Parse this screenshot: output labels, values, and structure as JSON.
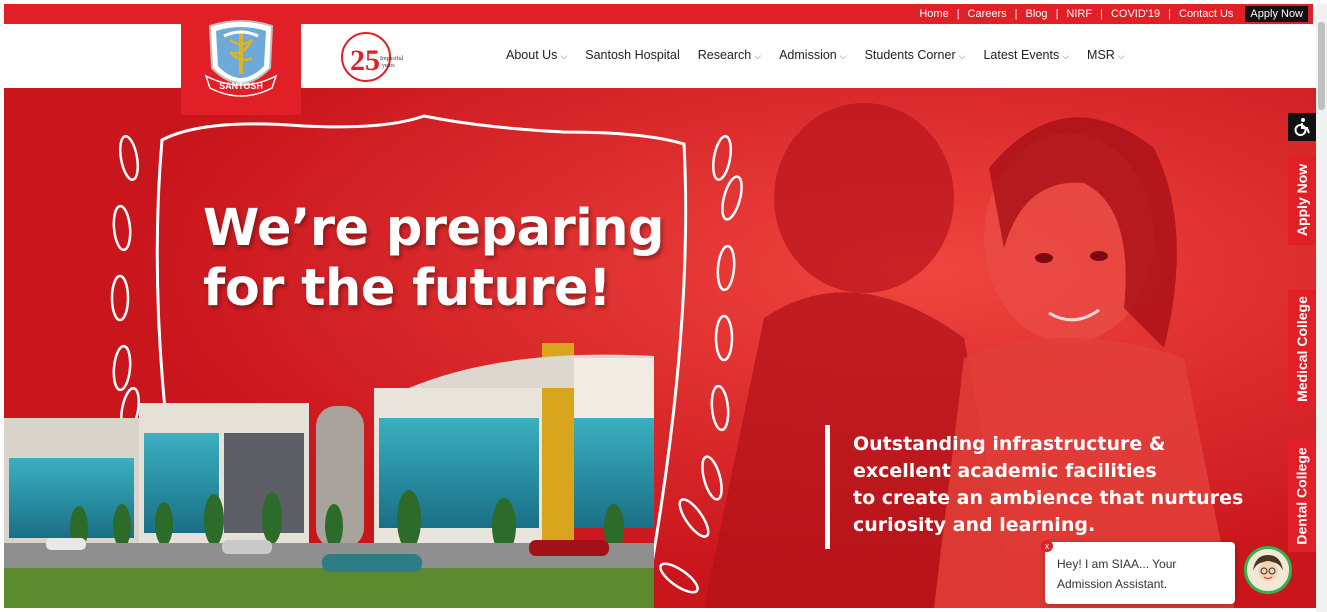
{
  "topbar": {
    "links": [
      "Home",
      "Careers",
      "Blog",
      "NIRF",
      "COVID'19",
      "Contact Us"
    ],
    "separator": "|",
    "apply_label": "Apply Now"
  },
  "logo": {
    "text": "SANTOSH"
  },
  "badge": {
    "number": "25",
    "line1": "Impactful",
    "line2": "years"
  },
  "nav": {
    "items": [
      {
        "label": "About Us",
        "has_dropdown": true
      },
      {
        "label": "Santosh Hospital",
        "has_dropdown": false
      },
      {
        "label": "Research",
        "has_dropdown": true
      },
      {
        "label": "Admission",
        "has_dropdown": true
      },
      {
        "label": "Students Corner",
        "has_dropdown": true
      },
      {
        "label": "Latest Events",
        "has_dropdown": true
      },
      {
        "label": "MSR",
        "has_dropdown": true
      }
    ],
    "chevron": "⌵"
  },
  "hero": {
    "headline_line1": "We’re preparing",
    "headline_line2": "for the future!",
    "tagline": [
      "Outstanding infrastructure &",
      "excellent academic facilities",
      "to create an ambience that nurtures",
      "curiosity and learning."
    ]
  },
  "side_tabs": {
    "accessibility_icon": "accessibility-icon",
    "apply_now": "Apply Now",
    "medical_college": "Medical College",
    "dental_college": "Dental College"
  },
  "chat": {
    "line1": "Hey! I am SIAA... Your",
    "line2": "Admission Assistant.",
    "close": "x"
  },
  "colors": {
    "brand_red": "#e11f26",
    "dark": "#111111",
    "green": "#2fb54a"
  }
}
